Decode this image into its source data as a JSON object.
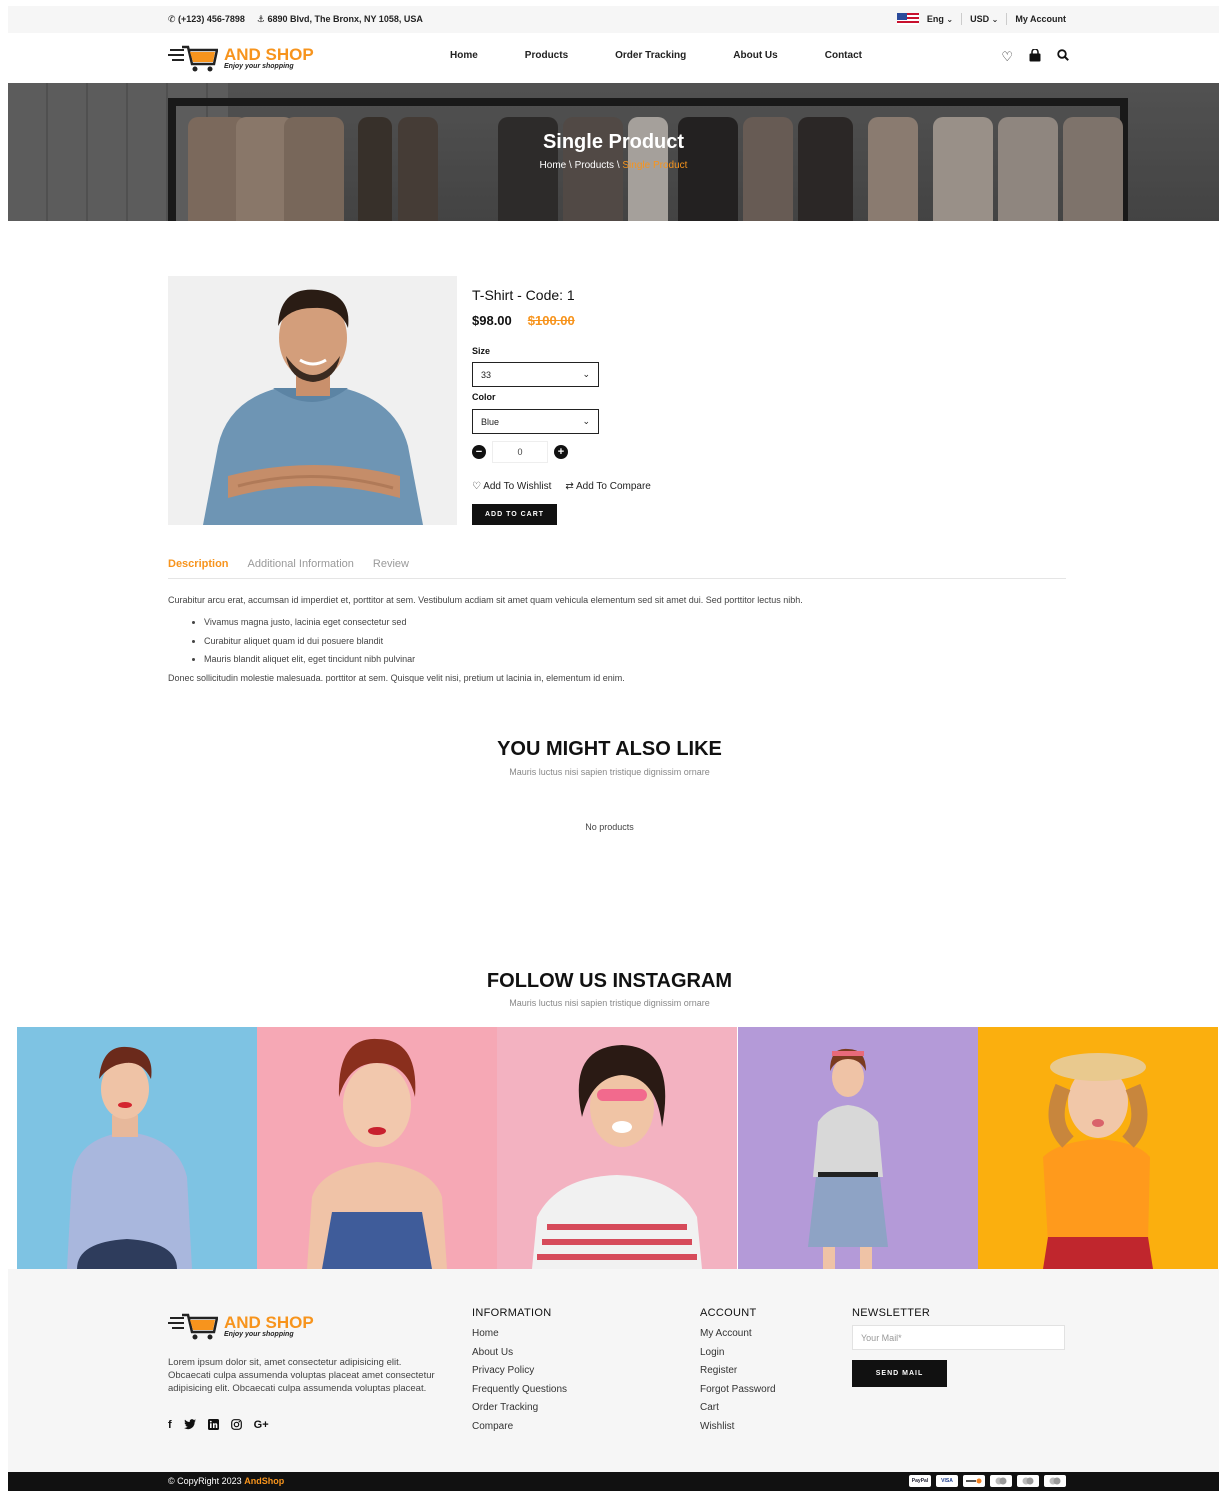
{
  "topbar": {
    "phone": "(+123) 456-7898",
    "address": "6890 Blvd, The Bronx, NY 1058, USA",
    "language": "Eng",
    "currency": "USD",
    "account": "My Account"
  },
  "brand": {
    "name": "AND SHOP",
    "tagline": "Enjoy your shopping"
  },
  "nav": [
    "Home",
    "Products",
    "Order Tracking",
    "About Us",
    "Contact"
  ],
  "hero": {
    "title": "Single Product",
    "crumbs": [
      "Home",
      "Products",
      "Single Product"
    ],
    "crumb_sep": "\\"
  },
  "product": {
    "title": "T-Shirt - Code: 1",
    "price": "$98.00",
    "old_price": "$100.00",
    "size_label": "Size",
    "size_value": "33",
    "color_label": "Color",
    "color_value": "Blue",
    "quantity": "0",
    "wishlist": "Add To Wishlist",
    "compare": "Add To Compare",
    "add_to_cart": "ADD TO CART"
  },
  "tabs": [
    "Description",
    "Additional Information",
    "Review"
  ],
  "description": {
    "intro": "Curabitur arcu erat, accumsan id imperdiet et, porttitor at sem. Vestibulum acdiam sit amet quam vehicula elementum sed sit amet dui. Sed porttitor lectus nibh.",
    "bullets": [
      "Vivamus magna justo, lacinia eget consectetur sed",
      "Curabitur aliquet quam id dui posuere blandit",
      "Mauris blandit aliquet elit, eget tincidunt nibh pulvinar"
    ],
    "outro": "Donec sollicitudin molestie malesuada. porttitor at sem. Quisque velit nisi, pretium ut lacinia in, elementum id enim."
  },
  "related": {
    "title": "YOU MIGHT ALSO LIKE",
    "subtitle": "Mauris luctus nisi sapien tristique dignissim ornare",
    "empty": "No products"
  },
  "instagram": {
    "title": "FOLLOW US INSTAGRAM",
    "subtitle": "Mauris luctus nisi sapien tristique dignissim ornare",
    "tiles": [
      "#7ec3e3",
      "#f6a8b5",
      "#f3b2c1",
      "#b49ad8",
      "#fbaf0e"
    ]
  },
  "footer": {
    "about": "Lorem ipsum dolor sit, amet consectetur adipisicing elit. Obcaecati culpa assumenda voluptas placeat amet consectetur adipisicing elit. Obcaecati culpa assumenda voluptas placeat.",
    "social": [
      "f",
      "G+"
    ],
    "information_title": "INFORMATION",
    "information": [
      "Home",
      "About Us",
      "Privacy Policy",
      "Frequently Questions",
      "Order Tracking",
      "Compare"
    ],
    "account_title": "ACCOUNT",
    "account": [
      "My Account",
      "Login",
      "Register",
      "Forgot Password",
      "Cart",
      "Wishlist"
    ],
    "newsletter_title": "NEWSLETTER",
    "newsletter_placeholder": "Your Mail*",
    "newsletter_button": "SEND MAIL"
  },
  "bottom": {
    "copyright": "© CopyRight 2023",
    "brand": "AndShop",
    "payments": [
      "PayPal",
      "VISA"
    ]
  },
  "colors": {
    "accent": "#f7941d",
    "dark": "#111111",
    "light_bg": "#f6f6f6"
  }
}
